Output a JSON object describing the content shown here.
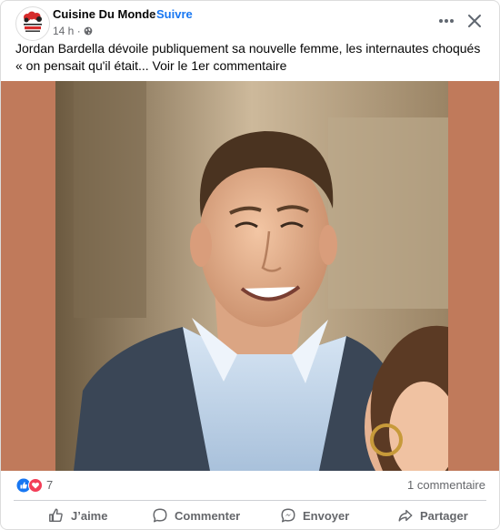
{
  "page": {
    "name": "Cuisine Du Monde",
    "separator": "·",
    "follow_label": "Suivre",
    "time": "14 h ·",
    "logo_text": "CUISINE DU MONDE"
  },
  "post": {
    "text": "Jordan Bardella dévoile publiquement sa nouvelle femme, les internautes choqués « on pensait qu'il était... Voir le 1er commentaire"
  },
  "reactions": {
    "count": "7",
    "types": [
      "like-icon",
      "love-icon"
    ],
    "comments": "1 commentaire"
  },
  "actions": {
    "like": "J’aime",
    "comment": "Commenter",
    "send": "Envoyer",
    "share": "Partager"
  },
  "colors": {
    "brand_blue": "#1877f2",
    "love_red": "#f33e58",
    "photo_border": "#c07a5b"
  },
  "icons": {
    "more": "more-options-icon",
    "close": "close-icon",
    "globe": "globe-icon"
  }
}
